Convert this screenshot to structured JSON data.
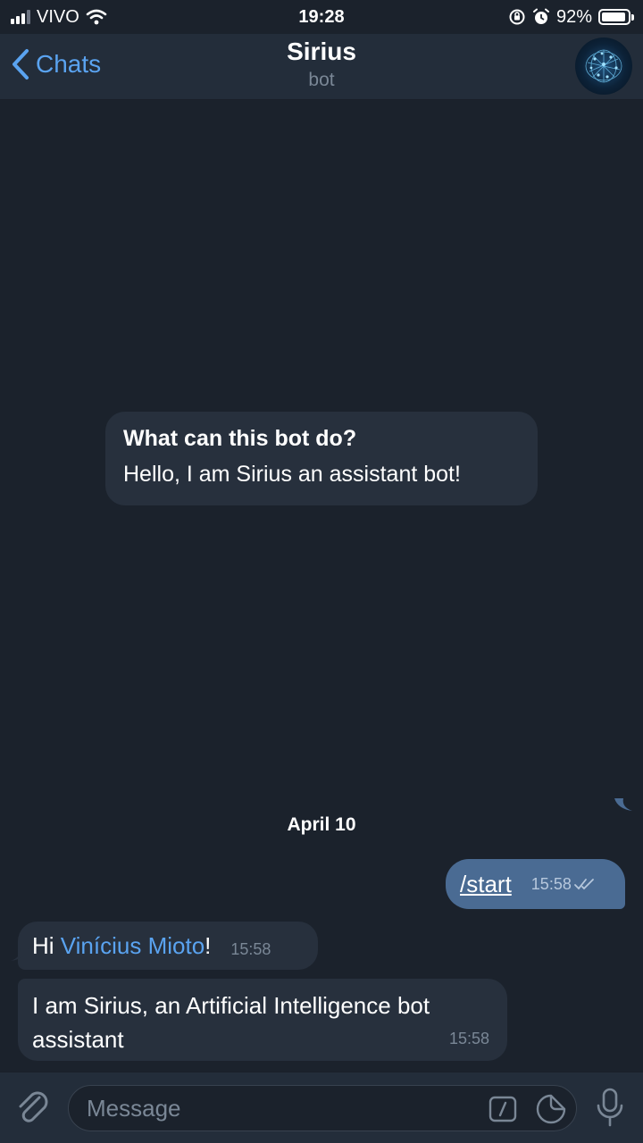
{
  "status_bar": {
    "carrier": "VIVO",
    "time": "19:28",
    "battery_percent_text": "92%",
    "battery_level": 0.92
  },
  "header": {
    "back_label": "Chats",
    "title": "Sirius",
    "subtitle": "bot",
    "avatar_icon": "brain-network-avatar"
  },
  "bot_info": {
    "title": "What can this bot do?",
    "description": "Hello, I am Sirius an assistant bot!"
  },
  "date_separator": "April 10",
  "messages": [
    {
      "direction": "outgoing",
      "text": "/start",
      "time": "15:58",
      "status": "read"
    },
    {
      "direction": "incoming",
      "prefix": "Hi ",
      "mention": "Vinícius Mioto",
      "suffix": "!",
      "time": "15:58"
    },
    {
      "direction": "incoming",
      "line1": "I am Sirius, an Artificial Intelligence bot",
      "line2": "assistant",
      "time": "15:58"
    }
  ],
  "input_bar": {
    "placeholder": "Message",
    "icons": [
      "paperclip-icon",
      "bot-command-icon",
      "sticker-icon",
      "microphone-icon"
    ]
  },
  "colors": {
    "background": "#1b222c",
    "header": "#232d3a",
    "accent": "#5aa3f0",
    "outgoing_bubble": "#4a6b93",
    "incoming_bubble": "#27303d"
  }
}
